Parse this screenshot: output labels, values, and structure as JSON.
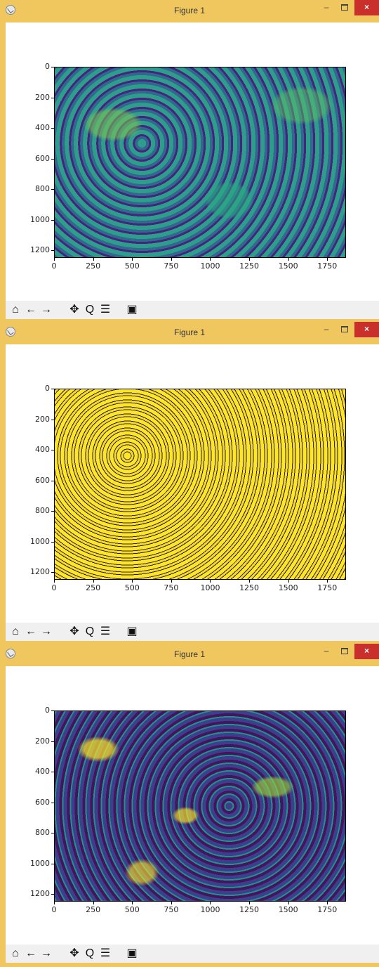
{
  "windows": [
    {
      "title": "Figure 1",
      "colormap_colors": [
        "#44247c",
        "#31688e",
        "#2f9d8c",
        "#7cc850"
      ],
      "y_ticks": [
        "0",
        "200",
        "400",
        "600",
        "800",
        "1000",
        "1200"
      ],
      "x_ticks": [
        "0",
        "250",
        "500",
        "750",
        "1000",
        "1250",
        "1500",
        "1750"
      ]
    },
    {
      "title": "Figure 1",
      "colormap_colors": [
        "#3b1c54",
        "#fde725"
      ],
      "y_ticks": [
        "0",
        "200",
        "400",
        "600",
        "800",
        "1000",
        "1200"
      ],
      "x_ticks": [
        "0",
        "250",
        "500",
        "750",
        "1000",
        "1250",
        "1500",
        "1750"
      ]
    },
    {
      "title": "Figure 1",
      "colormap_colors": [
        "#44145c",
        "#3c3f8c",
        "#21918c",
        "#fde725"
      ],
      "y_ticks": [
        "0",
        "200",
        "400",
        "600",
        "800",
        "1000",
        "1200"
      ],
      "x_ticks": [
        "0",
        "250",
        "500",
        "750",
        "1000",
        "1250",
        "1500",
        "1750"
      ]
    }
  ],
  "window_controls": {
    "close_glyph": "×"
  },
  "toolbar": {
    "icons": [
      "home-icon",
      "back-arrow-icon",
      "forward-arrow-icon",
      "pan-icon",
      "zoom-icon",
      "configure-subplots-icon",
      "save-icon"
    ],
    "glyphs": {
      "home": "⌂",
      "back": "←",
      "forward": "→",
      "pan": "✥",
      "zoom": "Q",
      "configure": "☰",
      "save": "▣"
    }
  },
  "theme": {
    "titlebar_color": "#f0c75e",
    "close_button_color": "#c9302c"
  }
}
